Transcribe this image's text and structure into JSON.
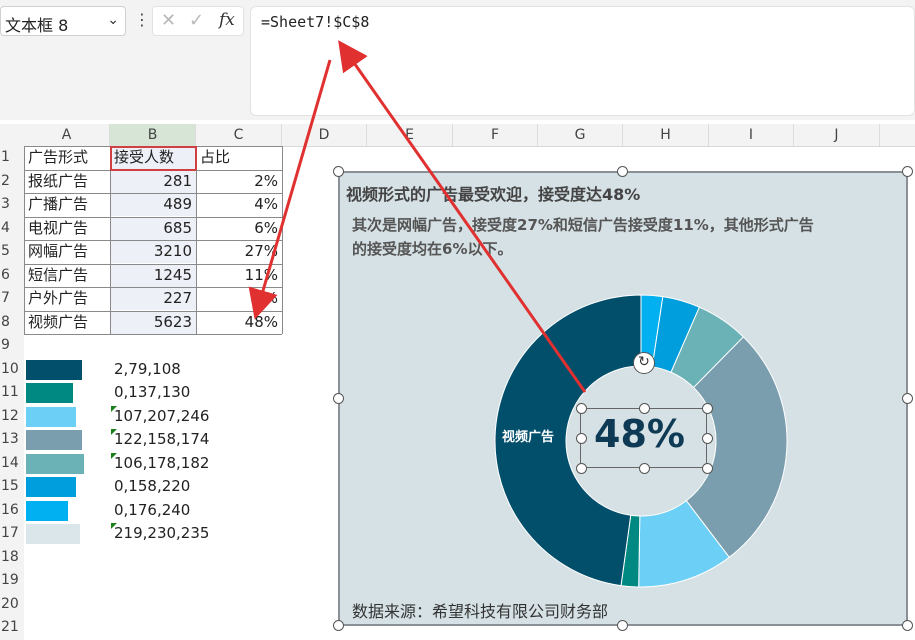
{
  "namebox": {
    "value": "文本框 8",
    "dropdown_icon": "chevron-down-icon"
  },
  "formula_bar": {
    "cancel_icon": "close-icon",
    "confirm_icon": "check-icon",
    "fx_label": "fx",
    "formula": "=Sheet7!$C$8"
  },
  "columns": [
    "A",
    "B",
    "C",
    "D",
    "E",
    "F",
    "G",
    "H",
    "I",
    "J"
  ],
  "rows": [
    "1",
    "2",
    "3",
    "4",
    "5",
    "6",
    "7",
    "8",
    "9",
    "10",
    "11",
    "12",
    "13",
    "14",
    "15",
    "16",
    "17",
    "18",
    "19",
    "20",
    "21"
  ],
  "table": {
    "headers": [
      "广告形式",
      "接受人数",
      "占比"
    ],
    "rows": [
      [
        "报纸广告",
        "281",
        "2%"
      ],
      [
        "广播广告",
        "489",
        "4%"
      ],
      [
        "电视广告",
        "685",
        "6%"
      ],
      [
        "网幅广告",
        "3210",
        "27%"
      ],
      [
        "短信广告",
        "1245",
        "11%"
      ],
      [
        "户外广告",
        "227",
        "2%"
      ],
      [
        "视频广告",
        "5623",
        "48%"
      ]
    ]
  },
  "color_legend": [
    {
      "rgb": "2,79,108",
      "color": "#024f6c"
    },
    {
      "rgb": "0,137,130",
      "color": "#008982"
    },
    {
      "rgb": "107,207,246",
      "color": "#6bcff6"
    },
    {
      "rgb": "122,158,174",
      "color": "#7a9eae"
    },
    {
      "rgb": "106,178,182",
      "color": "#6ab2b6"
    },
    {
      "rgb": "0,158,220",
      "color": "#009edc"
    },
    {
      "rgb": "0,176,240",
      "color": "#00b0f0"
    },
    {
      "rgb": "219,230,235",
      "color": "#dbe6eb"
    }
  ],
  "chart": {
    "title": "视频形式的广告最受欢迎，接受度达48%",
    "subtitle": "其次是网幅广告，接受度27%和短信广告接受度11%，其他形式广告的接受度均在6%以下。",
    "source": "数据来源：希望科技有限公司财务部",
    "center_value": "48%",
    "slice_label": "视频广告"
  },
  "chart_data": {
    "type": "pie",
    "variant": "donut",
    "categories": [
      "报纸广告",
      "广播广告",
      "电视广告",
      "网幅广告",
      "短信广告",
      "户外广告",
      "视频广告"
    ],
    "values": [
      281,
      489,
      685,
      3210,
      1245,
      227,
      5623
    ],
    "colors": [
      "#00b0f0",
      "#009edc",
      "#6ab2b6",
      "#7a9eae",
      "#6bcff6",
      "#008982",
      "#024f6c"
    ]
  }
}
